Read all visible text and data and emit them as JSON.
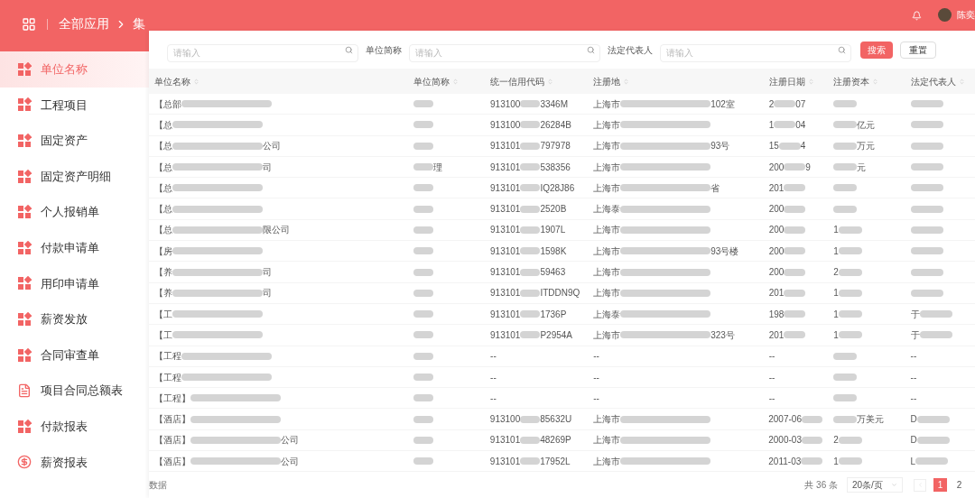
{
  "header": {
    "breadcrumb": [
      "全部应用",
      "集"
    ],
    "user_name": "陈奕"
  },
  "sidebar": {
    "items": [
      {
        "label": "单位名称",
        "kind": "grid",
        "selected": true
      },
      {
        "label": "工程项目",
        "kind": "grid",
        "selected": false
      },
      {
        "label": "固定资产",
        "kind": "grid",
        "selected": false
      },
      {
        "label": "固定资产明细",
        "kind": "grid",
        "selected": false
      },
      {
        "label": "个人报销单",
        "kind": "grid",
        "selected": false
      },
      {
        "label": "付款申请单",
        "kind": "grid",
        "selected": false
      },
      {
        "label": "用印申请单",
        "kind": "grid",
        "selected": false
      },
      {
        "label": "薪资发放",
        "kind": "grid",
        "selected": false
      },
      {
        "label": "合同审查单",
        "kind": "grid",
        "selected": false
      },
      {
        "label": "项目合同总额表",
        "kind": "doc",
        "selected": false
      },
      {
        "label": "付款报表",
        "kind": "grid",
        "selected": false
      },
      {
        "label": "薪资报表",
        "kind": "yen",
        "selected": false
      }
    ]
  },
  "filters": [
    {
      "placeholder": "请输入"
    },
    {
      "label": "单位简称",
      "placeholder": "请输入"
    },
    {
      "label": "法定代表人",
      "placeholder": "请输入"
    }
  ],
  "buttons": {
    "search": "搜索",
    "reset": "重置"
  },
  "table": {
    "columns": [
      "单位名称",
      "单位简称",
      "统一信用代码",
      "注册地",
      "注册日期",
      "注册资本",
      "法定代表人"
    ],
    "rows": [
      [
        {
          "t": "【总部",
          "blur": true
        },
        {
          "blur": true
        },
        {
          "t": "913100",
          "u": "3346M",
          "blur": true
        },
        {
          "t": "上海市",
          "u": "102室",
          "blur": true
        },
        {
          "t": "2",
          "u": "07",
          "blur": true
        },
        {
          "blur": true
        },
        {
          "blur": true
        }
      ],
      [
        {
          "t": "【总",
          "blur": true
        },
        {
          "blur": true
        },
        {
          "t": "913100",
          "u": "26284B",
          "blur": true
        },
        {
          "t": "上海市",
          "blur": true
        },
        {
          "t": "1",
          "u": "04",
          "blur": true
        },
        {
          "u": "亿元",
          "blur": true
        },
        {
          "blur": true
        }
      ],
      [
        {
          "t": "【总",
          "u": "公司",
          "blur": true
        },
        {
          "blur": true
        },
        {
          "t": "913101",
          "u": "797978",
          "blur": true
        },
        {
          "t": "上海市",
          "u": "93号",
          "blur": true
        },
        {
          "t": "15",
          "u": "4",
          "blur": true
        },
        {
          "u": "万元",
          "blur": true
        },
        {
          "blur": true
        }
      ],
      [
        {
          "t": "【总",
          "u": "司",
          "blur": true
        },
        {
          "u": "理",
          "blur": true
        },
        {
          "t": "913101",
          "u": "538356",
          "blur": true
        },
        {
          "t": "上海市",
          "blur": true
        },
        {
          "t": "200",
          "u": "9",
          "blur": true
        },
        {
          "u": "元",
          "blur": true
        },
        {
          "blur": true
        }
      ],
      [
        {
          "t": "【总",
          "blur": true
        },
        {
          "blur": true
        },
        {
          "t": "913101",
          "u": "IQ28J86",
          "blur": true
        },
        {
          "t": "上海市",
          "u": "省",
          "blur": true
        },
        {
          "t": "201",
          "blur": true
        },
        {
          "blur": true
        },
        {
          "blur": true
        }
      ],
      [
        {
          "t": "【总",
          "blur": true
        },
        {
          "blur": true
        },
        {
          "t": "913101",
          "u": "2520B",
          "blur": true
        },
        {
          "t": "上海泰",
          "blur": true
        },
        {
          "t": "200",
          "blur": true
        },
        {
          "blur": true
        },
        {
          "blur": true
        }
      ],
      [
        {
          "t": "【总",
          "u": "限公司",
          "blur": true
        },
        {
          "blur": true
        },
        {
          "t": "913101",
          "u": "1907L",
          "blur": true
        },
        {
          "t": "上海市",
          "blur": true
        },
        {
          "t": "200",
          "blur": true
        },
        {
          "t": "1",
          "blur": true
        },
        {
          "blur": true
        }
      ],
      [
        {
          "t": "【房",
          "blur": true
        },
        {
          "blur": true
        },
        {
          "t": "913101",
          "u": "1598K",
          "blur": true
        },
        {
          "t": "上海市",
          "u": "93号楼",
          "blur": true
        },
        {
          "t": "200",
          "blur": true
        },
        {
          "t": "1",
          "blur": true
        },
        {
          "blur": true
        }
      ],
      [
        {
          "t": "【养",
          "u": "司",
          "blur": true
        },
        {
          "blur": true
        },
        {
          "t": "913101",
          "u": "59463",
          "blur": true
        },
        {
          "t": "上海市",
          "blur": true
        },
        {
          "t": "200",
          "blur": true
        },
        {
          "t": "2",
          "blur": true
        },
        {
          "blur": true
        }
      ],
      [
        {
          "t": "【养",
          "u": "司",
          "blur": true
        },
        {
          "blur": true
        },
        {
          "t": "913101",
          "u": "ITDDN9Q",
          "blur": true
        },
        {
          "t": "上海市",
          "blur": true
        },
        {
          "t": "201",
          "blur": true
        },
        {
          "t": "1",
          "blur": true
        },
        {
          "blur": true
        }
      ],
      [
        {
          "t": "【工",
          "blur": true
        },
        {
          "blur": true
        },
        {
          "t": "913101",
          "u": "1736P",
          "blur": true
        },
        {
          "t": "上海泰",
          "blur": true
        },
        {
          "t": "198",
          "blur": true
        },
        {
          "t": "1",
          "blur": true
        },
        {
          "t": "于",
          "blur": true
        }
      ],
      [
        {
          "t": "【工",
          "blur": true
        },
        {
          "blur": true
        },
        {
          "t": "913101",
          "u": "P2954A",
          "blur": true
        },
        {
          "t": "上海市",
          "u": "323号",
          "blur": true
        },
        {
          "t": "201",
          "blur": true
        },
        {
          "t": "1",
          "blur": true
        },
        {
          "t": "于",
          "blur": true
        }
      ],
      [
        {
          "t": "【工程",
          "blur": true
        },
        {
          "blur": true
        },
        {
          "t": "--"
        },
        {
          "t": "--"
        },
        {
          "t": "--"
        },
        {
          "blur": true
        },
        {
          "t": "--"
        }
      ],
      [
        {
          "t": "【工程",
          "blur": true
        },
        {
          "blur": true
        },
        {
          "t": "--"
        },
        {
          "t": "--"
        },
        {
          "t": "--"
        },
        {
          "blur": true
        },
        {
          "t": "--"
        }
      ],
      [
        {
          "t": "【工程】",
          "blur": true
        },
        {
          "blur": true
        },
        {
          "t": "--"
        },
        {
          "t": "--"
        },
        {
          "t": "--"
        },
        {
          "blur": true
        },
        {
          "t": "--"
        }
      ],
      [
        {
          "t": "【酒店】",
          "blur": true
        },
        {
          "blur": true
        },
        {
          "t": "913100",
          "u": "85632U",
          "blur": true
        },
        {
          "t": "上海市",
          "blur": true
        },
        {
          "t": "2007-06",
          "blur": true
        },
        {
          "u": "万美元",
          "blur": true
        },
        {
          "t": "D",
          "blur": true
        }
      ],
      [
        {
          "t": "【酒店】",
          "u": "公司",
          "blur": true
        },
        {
          "blur": true
        },
        {
          "t": "913101",
          "u": "48269P",
          "blur": true
        },
        {
          "t": "上海市",
          "blur": true
        },
        {
          "t": "2000-03",
          "blur": true
        },
        {
          "t": "2",
          "blur": true
        },
        {
          "t": "D",
          "blur": true
        }
      ],
      [
        {
          "t": "【酒店】",
          "u": "公司",
          "blur": true
        },
        {
          "blur": true
        },
        {
          "t": "913101",
          "u": "17952L",
          "blur": true
        },
        {
          "t": "上海市",
          "blur": true
        },
        {
          "t": "2011-03",
          "blur": true
        },
        {
          "t": "1",
          "blur": true
        },
        {
          "t": "L",
          "blur": true
        }
      ]
    ]
  },
  "footer": {
    "note": "数据",
    "total": "共 36 条",
    "page_size": "20条/页",
    "pages": [
      {
        "label": "1",
        "selected": true
      },
      {
        "label": "2",
        "selected": false
      }
    ]
  }
}
